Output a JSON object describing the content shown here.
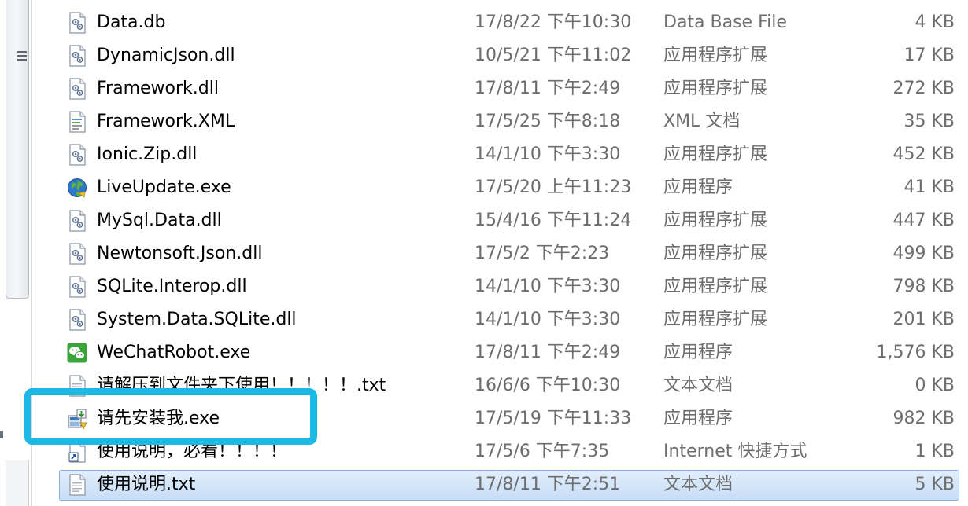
{
  "files": [
    {
      "name": "Data.db",
      "date": "17/8/22 下午10:30",
      "type": "Data Base File",
      "size": "4 KB",
      "icon": "dll-file-icon"
    },
    {
      "name": "DynamicJson.dll",
      "date": "10/5/21 下午11:02",
      "type": "应用程序扩展",
      "size": "17 KB",
      "icon": "dll-file-icon"
    },
    {
      "name": "Framework.dll",
      "date": "17/8/11 下午2:49",
      "type": "应用程序扩展",
      "size": "272 KB",
      "icon": "dll-file-icon"
    },
    {
      "name": "Framework.XML",
      "date": "17/5/25 下午8:18",
      "type": "XML 文档",
      "size": "35 KB",
      "icon": "xml-file-icon"
    },
    {
      "name": "Ionic.Zip.dll",
      "date": "14/1/10 下午3:30",
      "type": "应用程序扩展",
      "size": "452 KB",
      "icon": "dll-file-icon"
    },
    {
      "name": "LiveUpdate.exe",
      "date": "17/5/20 上午11:23",
      "type": "应用程序",
      "size": "41 KB",
      "icon": "globe-icon"
    },
    {
      "name": "MySql.Data.dll",
      "date": "15/4/16 下午11:24",
      "type": "应用程序扩展",
      "size": "447 KB",
      "icon": "dll-file-icon"
    },
    {
      "name": "Newtonsoft.Json.dll",
      "date": "17/5/2 下午2:23",
      "type": "应用程序扩展",
      "size": "499 KB",
      "icon": "dll-file-icon"
    },
    {
      "name": "SQLite.Interop.dll",
      "date": "14/1/10 下午3:30",
      "type": "应用程序扩展",
      "size": "798 KB",
      "icon": "dll-file-icon"
    },
    {
      "name": "System.Data.SQLite.dll",
      "date": "14/1/10 下午3:30",
      "type": "应用程序扩展",
      "size": "201 KB",
      "icon": "dll-file-icon"
    },
    {
      "name": "WeChatRobot.exe",
      "date": "17/8/11 下午2:49",
      "type": "应用程序",
      "size": "1,576 KB",
      "icon": "wechat-icon"
    },
    {
      "name": "请解压到文件夹下使用！！！！！.txt",
      "date": "16/6/6 下午10:30",
      "type": "文本文档",
      "size": "0 KB",
      "icon": "text-file-icon"
    },
    {
      "name": "请先安装我.exe",
      "date": "17/5/19 下午11:33",
      "type": "应用程序",
      "size": "982 KB",
      "icon": "installer-icon"
    },
    {
      "name": "使用说明，必看！！！！",
      "date": "17/5/6 下午7:35",
      "type": "Internet 快捷方式",
      "size": "1 KB",
      "icon": "shortcut-icon"
    },
    {
      "name": "使用说明.txt",
      "date": "17/8/11 下午2:51",
      "type": "文本文档",
      "size": "5 KB",
      "icon": "text-file-icon",
      "selected": true
    }
  ],
  "colors": {
    "highlight": "#1cb8e6",
    "selection": "#c6ddf6",
    "muted_text": "#6d6d6d"
  }
}
